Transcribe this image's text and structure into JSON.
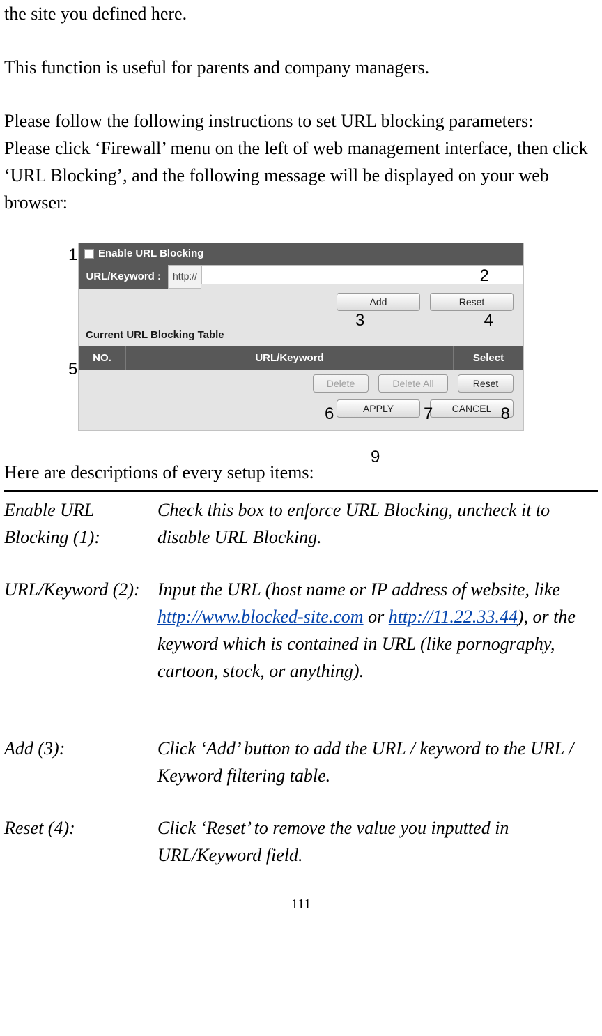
{
  "intro": {
    "line1": "the site you defined here.",
    "line2": "This function is useful for parents and company managers.",
    "instr_a": "Please follow the following instructions to set URL blocking parameters:",
    "instr_b": "Please click ‘Firewall’ menu on the left of web management interface, then click ‘URL Blocking’, and the following message will be displayed on your web browser:"
  },
  "screenshot": {
    "enable_label": "Enable URL Blocking",
    "url_keyword_label": "URL/Keyword :",
    "http_prefix": "http://",
    "url_input_value": "",
    "add_btn": "Add",
    "reset_btn": "Reset",
    "table_title": "Current URL Blocking Table",
    "th_no": "NO.",
    "th_url": "URL/Keyword",
    "th_select": "Select",
    "delete_btn": "Delete",
    "delete_all_btn": "Delete All",
    "reset2_btn": "Reset",
    "apply_btn": "APPLY",
    "cancel_btn": "CANCEL"
  },
  "callouts": {
    "c1": "1",
    "c2": "2",
    "c3": "3",
    "c4": "4",
    "c5": "5",
    "c6": "6",
    "c7": "7",
    "c8": "8",
    "c9": "9"
  },
  "desc_heading": "Here are descriptions of every setup items:",
  "items": {
    "enable": {
      "label": "Enable URL Blocking (1):",
      "desc": "Check this box to enforce URL Blocking, uncheck it to disable URL Blocking."
    },
    "urlkey": {
      "label": "URL/Keyword (2):",
      "desc1": "Input the URL (host name or IP address of website, like ",
      "link1": "http://www.blocked-site.com",
      "desc2": " or ",
      "link2": "http://11.22.33.44",
      "desc3": "), or the keyword which is contained in URL (like pornography, cartoon, stock, or anything)."
    },
    "add": {
      "label": "Add (3):",
      "desc": "Click ‘Add’ button to add the URL / keyword to the URL / Keyword filtering table."
    },
    "reset": {
      "label": "Reset (4):",
      "desc": "Click ‘Reset’ to remove the value you inputted in URL/Keyword field."
    }
  },
  "page_number": "111"
}
